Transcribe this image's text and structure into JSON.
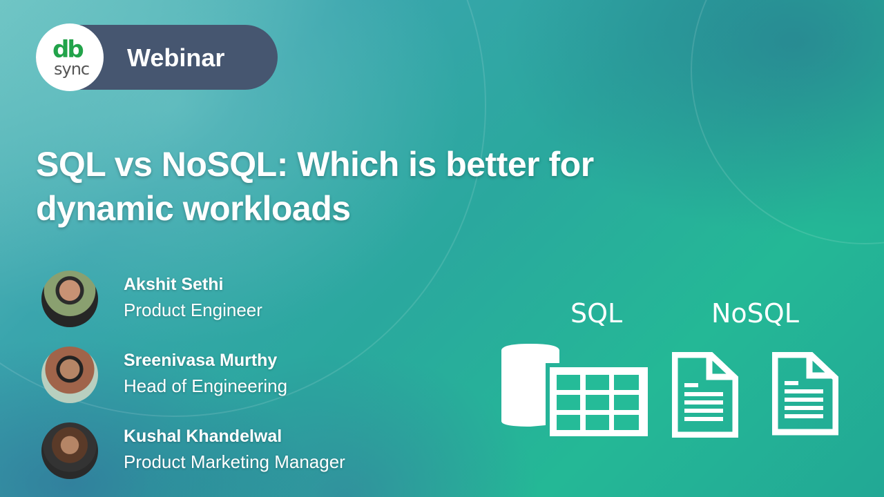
{
  "badge": {
    "logo_top": "db",
    "logo_bottom": "sync",
    "label": "Webinar"
  },
  "title": {
    "line1": "SQL vs NoSQL: Which is better for",
    "line2": "dynamic workloads"
  },
  "speakers": [
    {
      "name": "Akshit Sethi",
      "role": "Product Engineer"
    },
    {
      "name": "Sreenivasa Murthy",
      "role": "Head of Engineering"
    },
    {
      "name": "Kushal Khandelwal",
      "role": "Product Marketing Manager"
    }
  ],
  "illustration": {
    "sql_label": "SQL",
    "nosql_label": "NoSQL"
  },
  "colors": {
    "badge_bg": "#465670",
    "logo_green": "#22a34a",
    "accent_teal": "#24b896"
  }
}
